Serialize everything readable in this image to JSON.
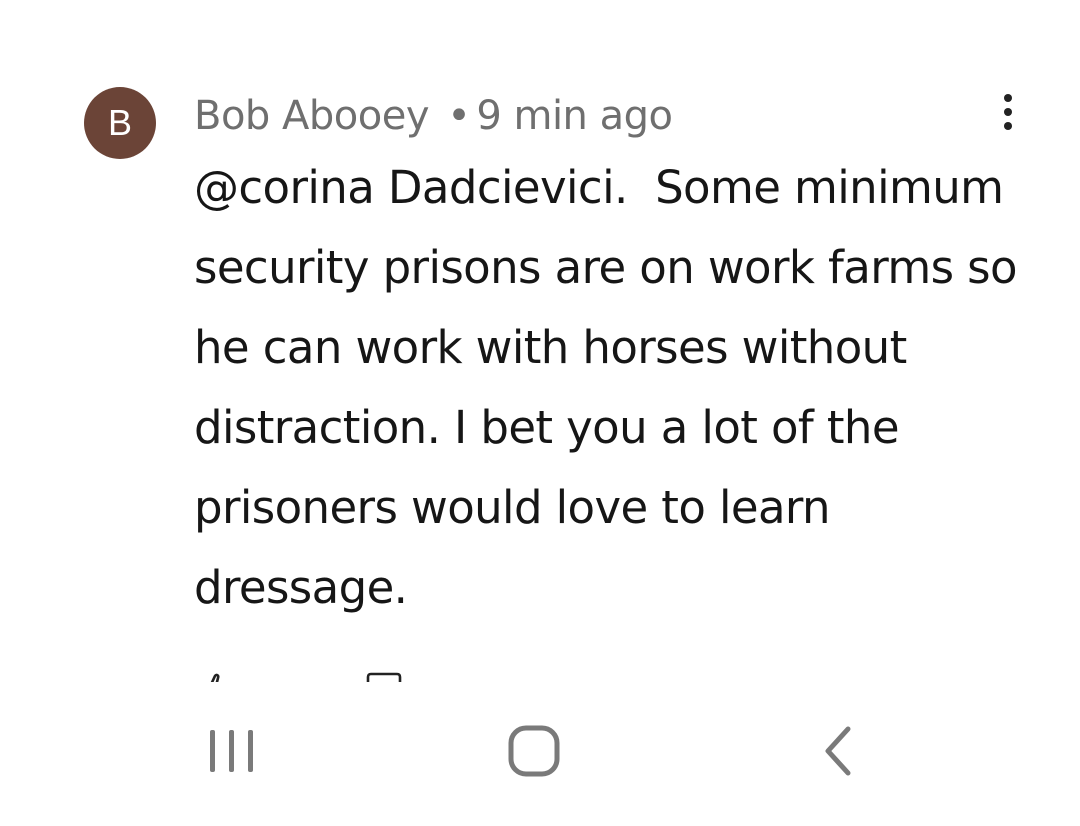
{
  "comment": {
    "avatar_letter": "B",
    "author": "Bob Abooey",
    "separator": "•",
    "time": "9 min ago",
    "text": "@corina Dadcievici.  Some minimum security prisons are on work farms so he can work with horses without distraction. I bet you a lot of the prisoners would love to learn dressage.",
    "more_icon": "more-vertical-icon",
    "avatar_color": "#6b4437"
  },
  "actions": {
    "like_icon": "thumb-up-icon",
    "reply_icon": "reply-icon"
  },
  "navigation": {
    "recent_icon": "recent-apps-icon",
    "home_icon": "home-icon",
    "back_icon": "back-icon"
  }
}
